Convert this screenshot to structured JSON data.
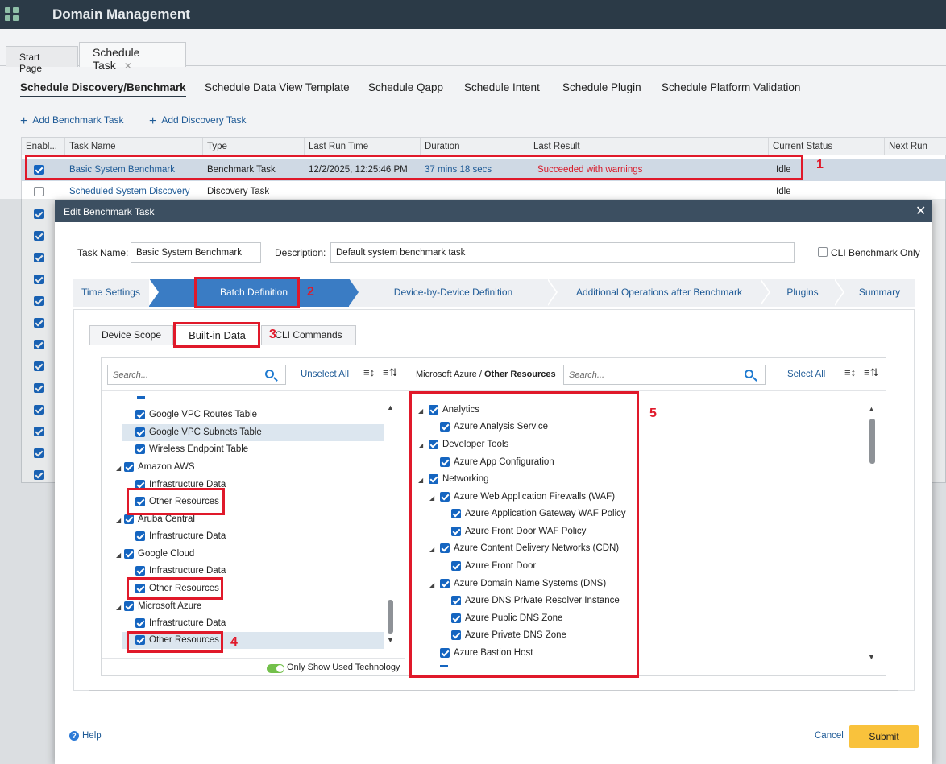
{
  "app": {
    "title": "Domain Management"
  },
  "page_tabs": [
    {
      "label": "Start Page"
    },
    {
      "label": "Schedule Task"
    }
  ],
  "sub_nav": [
    {
      "label": "Schedule Discovery/Benchmark"
    },
    {
      "label": "Schedule Data View Template"
    },
    {
      "label": "Schedule Qapp"
    },
    {
      "label": "Schedule Intent"
    },
    {
      "label": "Schedule Plugin"
    },
    {
      "label": "Schedule Platform Validation"
    }
  ],
  "actions": {
    "add_benchmark": "Add Benchmark Task",
    "add_discovery": "Add Discovery Task"
  },
  "task_table": {
    "columns": [
      "Enabl...",
      "Task Name",
      "Type",
      "Last Run Time",
      "Duration",
      "Last Result",
      "Current Status",
      "Next Run Time"
    ],
    "rows": [
      {
        "name": "Basic System Benchmark",
        "type": "Benchmark Task",
        "last_run": "12/2/2025, 12:25:46 PM",
        "duration": "37 mins 18 secs",
        "result": "Succeeded with warnings",
        "status": "Idle",
        "enabled": true
      },
      {
        "name": "Scheduled System Discovery",
        "type": "Discovery Task",
        "last_run": "",
        "duration": "",
        "result": "",
        "status": "Idle",
        "enabled": false
      }
    ]
  },
  "annotations": {
    "n1": "1",
    "n2": "2",
    "n3": "3",
    "n4": "4",
    "n5": "5"
  },
  "dialog": {
    "title": "Edit Benchmark Task",
    "task_name_label": "Task Name:",
    "task_name_value": "Basic System Benchmark",
    "description_label": "Description:",
    "description_value": "Default system benchmark task",
    "cli_only_label": "CLI Benchmark Only",
    "wizard_steps": [
      "Time Settings",
      "Batch Definition",
      "Device-by-Device Definition",
      "Additional Operations after Benchmark",
      "Plugins",
      "Summary"
    ],
    "tabs": [
      "Device Scope",
      "Built-in Data",
      "CLI Commands"
    ],
    "left": {
      "search_placeholder": "Search...",
      "unselect_all": "Unselect All",
      "items": [
        "Google VPC Routes Table",
        "Google VPC Subnets Table",
        "Wireless Endpoint Table",
        "Amazon AWS",
        "Infrastructure Data",
        "Other Resources",
        "Aruba Central",
        "Infrastructure Data",
        "Google Cloud",
        "Infrastructure Data",
        "Other Resources",
        "Microsoft Azure",
        "Infrastructure Data",
        "Other Resources"
      ],
      "only_used_label": "Only Show Used Technology"
    },
    "right": {
      "crumb_parent": "Microsoft Azure",
      "crumb_sep": "/",
      "crumb_current": "Other Resources",
      "search_placeholder": "Search...",
      "select_all": "Select All",
      "items": [
        "Analytics",
        "Azure Analysis Service",
        "Developer Tools",
        "Azure App Configuration",
        "Networking",
        "Azure Web Application Firewalls (WAF)",
        "Azure Application Gateway WAF Policy",
        "Azure Front Door WAF Policy",
        "Azure Content Delivery Networks (CDN)",
        "Azure Front Door",
        "Azure Domain Name Systems (DNS)",
        "Azure DNS Private Resolver Instance",
        "Azure Public DNS Zone",
        "Azure Private DNS Zone",
        "Azure Bastion Host"
      ]
    },
    "footer": {
      "help": "Help",
      "cancel": "Cancel",
      "submit": "Submit"
    }
  }
}
